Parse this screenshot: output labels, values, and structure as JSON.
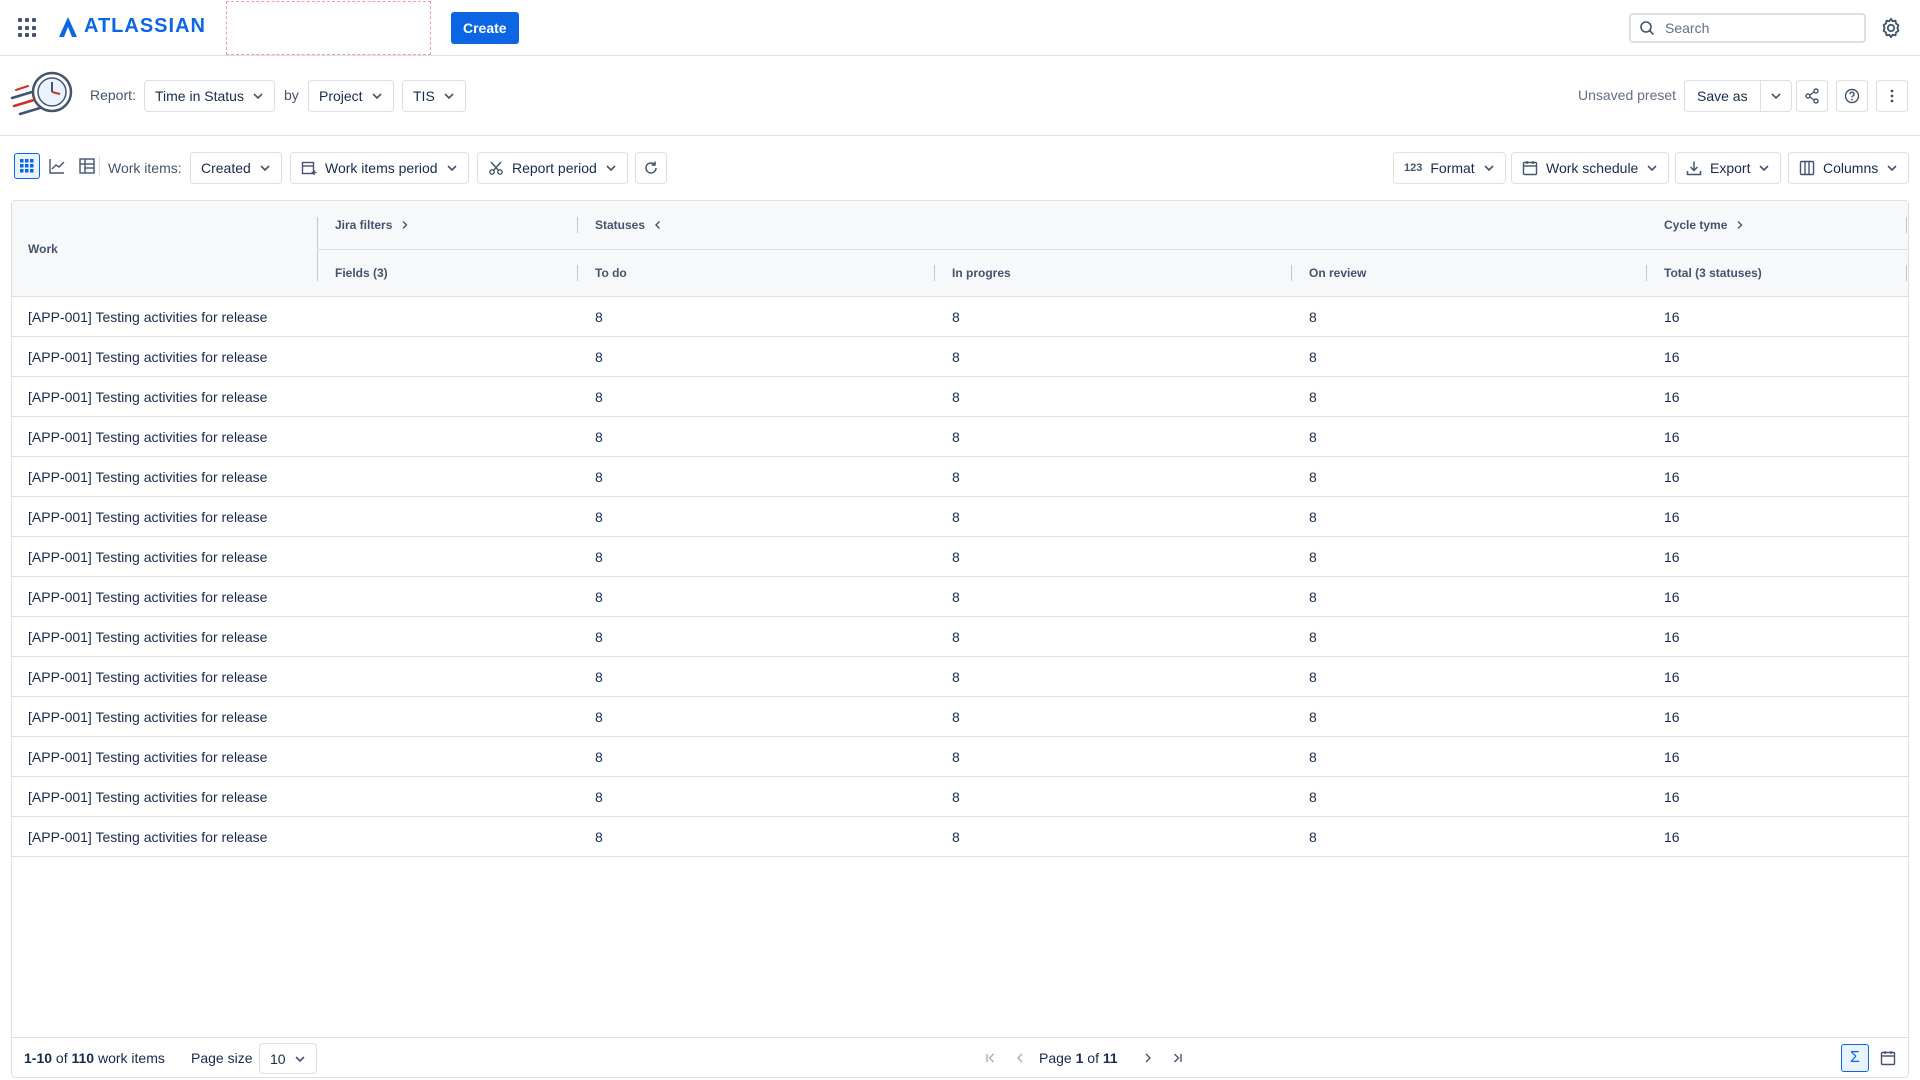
{
  "topnav": {
    "logo_text": "ATLASSIAN",
    "create_label": "Create",
    "search_placeholder": "Search",
    "brand_color": "#0c66e4"
  },
  "report": {
    "report_label": "Report:",
    "report_type": "Time in Status",
    "by_label": "by",
    "group_by": "Project",
    "project": "TIS",
    "unsaved_label": "Unsaved preset",
    "save_as_label": "Save as"
  },
  "toolbar": {
    "work_items_label": "Work items:",
    "created_label": "Created",
    "work_items_period_label": "Work items period",
    "report_period_label": "Report period",
    "format_label": "Format",
    "work_schedule_label": "Work schedule",
    "export_label": "Export",
    "columns_label": "Columns"
  },
  "table": {
    "headers": {
      "work": "Work",
      "jira_filters": "Jira filters",
      "statuses": "Statuses",
      "cycle_time": "Cycle tyme",
      "fields": "Fields (3)",
      "todo": "To do",
      "in_progress": "In progres",
      "on_review": "On review",
      "total": "Total (3 statuses)"
    },
    "rows": [
      {
        "work": "[APP-001] Testing activities for release",
        "todo": "8",
        "in_progress": "8",
        "on_review": "8",
        "total": "16"
      },
      {
        "work": "[APP-001] Testing activities for release",
        "todo": "8",
        "in_progress": "8",
        "on_review": "8",
        "total": "16"
      },
      {
        "work": "[APP-001] Testing activities for release",
        "todo": "8",
        "in_progress": "8",
        "on_review": "8",
        "total": "16"
      },
      {
        "work": "[APP-001] Testing activities for release",
        "todo": "8",
        "in_progress": "8",
        "on_review": "8",
        "total": "16"
      },
      {
        "work": "[APP-001] Testing activities for release",
        "todo": "8",
        "in_progress": "8",
        "on_review": "8",
        "total": "16"
      },
      {
        "work": "[APP-001] Testing activities for release",
        "todo": "8",
        "in_progress": "8",
        "on_review": "8",
        "total": "16"
      },
      {
        "work": "[APP-001] Testing activities for release",
        "todo": "8",
        "in_progress": "8",
        "on_review": "8",
        "total": "16"
      },
      {
        "work": "[APP-001] Testing activities for release",
        "todo": "8",
        "in_progress": "8",
        "on_review": "8",
        "total": "16"
      },
      {
        "work": "[APP-001] Testing activities for release",
        "todo": "8",
        "in_progress": "8",
        "on_review": "8",
        "total": "16"
      },
      {
        "work": "[APP-001] Testing activities for release",
        "todo": "8",
        "in_progress": "8",
        "on_review": "8",
        "total": "16"
      },
      {
        "work": "[APP-001] Testing activities for release",
        "todo": "8",
        "in_progress": "8",
        "on_review": "8",
        "total": "16"
      },
      {
        "work": "[APP-001] Testing activities for release",
        "todo": "8",
        "in_progress": "8",
        "on_review": "8",
        "total": "16"
      },
      {
        "work": "[APP-001] Testing activities for release",
        "todo": "8",
        "in_progress": "8",
        "on_review": "8",
        "total": "16"
      },
      {
        "work": "[APP-001] Testing activities for release",
        "todo": "8",
        "in_progress": "8",
        "on_review": "8",
        "total": "16"
      }
    ]
  },
  "footer": {
    "range": "1-10",
    "of_label": "of",
    "total_items": "110",
    "items_label": "work items",
    "page_size_label": "Page size",
    "page_size": "10",
    "page_label": "Page",
    "page_current": "1",
    "page_total": "11"
  }
}
